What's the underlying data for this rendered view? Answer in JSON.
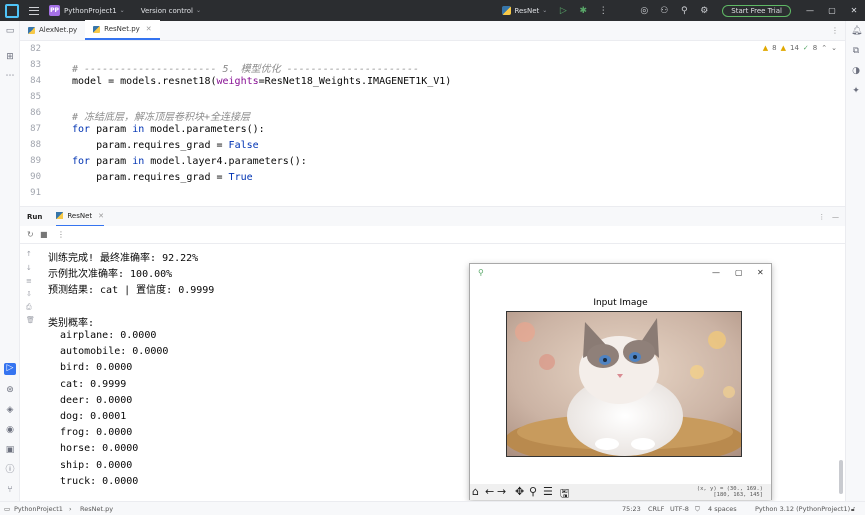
{
  "titlebar": {
    "project_badge": "PP",
    "project_name": "PythonProject1",
    "vcs": "Version control",
    "run_config": "ResNet",
    "trial_button": "Start Free Trial"
  },
  "tabs": [
    {
      "label": "AlexNet.py"
    },
    {
      "label": "ResNet.py"
    }
  ],
  "inspections": {
    "warnings": "8",
    "weak": "14",
    "ok": "8"
  },
  "editor": {
    "lines": [
      {
        "num": "82",
        "text": ""
      },
      {
        "num": "83",
        "text": "# ---------------------- 5. 模型优化 ----------------------"
      },
      {
        "num": "84",
        "text_pre": "model = models.resnet18(",
        "param": "weights",
        "text_post": "=ResNet18_Weights.IMAGENET1K_V1)"
      },
      {
        "num": "85",
        "text": ""
      },
      {
        "num": "86",
        "text": "# 冻结底层，解冻顶层卷积块+全连接层"
      },
      {
        "num": "87",
        "kw1": "for",
        "mid": " param ",
        "kw2": "in",
        "rest": " model.parameters():"
      },
      {
        "num": "88",
        "pre": "    param.requires_grad = ",
        "kw": "False"
      },
      {
        "num": "89",
        "kw1": "for",
        "mid": " param ",
        "kw2": "in",
        "rest": " model.layer4.parameters():"
      },
      {
        "num": "90",
        "pre": "    param.requires_grad = ",
        "kw": "True"
      },
      {
        "num": "91",
        "text": ""
      }
    ]
  },
  "run_panel": {
    "label": "Run",
    "tab": "ResNet"
  },
  "console": [
    "训练完成! 最终准确率: 92.22%",
    "示例批次准确率: 100.00%",
    "预测结果: cat | 置信度: 0.9999",
    "",
    "类别概率:",
    "  airplane: 0.0000",
    "  automobile: 0.0000",
    "  bird: 0.0000",
    "  cat: 0.9999",
    "  deer: 0.0000",
    "  dog: 0.0001",
    "  frog: 0.0000",
    "  horse: 0.0000",
    "  ship: 0.0000",
    "  truck: 0.0000"
  ],
  "figure": {
    "title": "Input Image",
    "coords_line1": "(x, y) = (30., 169.)",
    "coords_line2": "[180, 163, 145]"
  },
  "statusbar": {
    "breadcrumb_project": "PythonProject1",
    "breadcrumb_file": "ResNet.py",
    "position": "75:23",
    "line_sep": "CRLF",
    "encoding": "UTF-8",
    "indent": "4 spaces",
    "interpreter": "Python 3.12 (PythonProject1)"
  }
}
